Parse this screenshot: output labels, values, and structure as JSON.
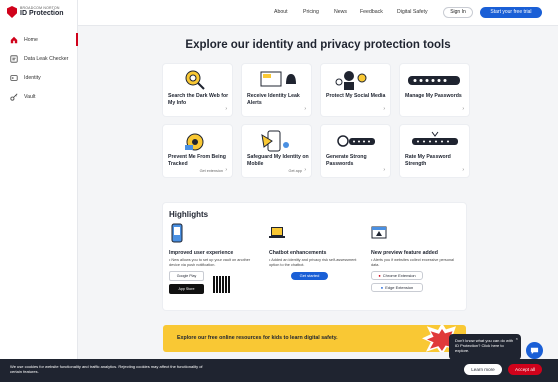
{
  "brand": {
    "top": "BROADCOM NORTON",
    "name": "ID Protection"
  },
  "sidebar": {
    "items": [
      {
        "label": "Home",
        "icon": "home-icon"
      },
      {
        "label": "Data Leak Checker",
        "icon": "data-leak-icon"
      },
      {
        "label": "Identity",
        "icon": "id-card-icon"
      },
      {
        "label": "Vault",
        "icon": "key-icon"
      }
    ]
  },
  "topnav": {
    "about": "About",
    "pricing": "Pricing",
    "news": "News",
    "feedback": "Feedback",
    "digital_safety": "Digital Safety",
    "sign_in": "Sign In",
    "trial": "Start your free trial"
  },
  "main": {
    "headline": "Explore our identity and privacy protection tools"
  },
  "tools": [
    {
      "title": "Search the Dark Web for My Info",
      "extra": ""
    },
    {
      "title": "Receive Identity Leak Alerts",
      "extra": ""
    },
    {
      "title": "Protect My Social Media",
      "extra": ""
    },
    {
      "title": "Manage My Passwords",
      "extra": ""
    },
    {
      "title": "Prevent Me From Being Tracked",
      "extra": "Get extension"
    },
    {
      "title": "Safeguard My Identity on Mobile",
      "extra": "Get app"
    },
    {
      "title": "Generate Strong Passwords",
      "extra": ""
    },
    {
      "title": "Rate My Password Strength",
      "extra": ""
    }
  ],
  "highlights": {
    "title": "Highlights",
    "col1": {
      "title": "Improved user experience",
      "bullets": [
        "New allows you to set up your vault on another device via push notification."
      ],
      "google": "Google Play",
      "apple": "App Store"
    },
    "col2": {
      "title": "Chatbot enhancements",
      "bullets": [
        "Added an identity and privacy risk self-assessment option to the chatbot."
      ],
      "button": "Get started"
    },
    "col3": {
      "title": "New preview feature added",
      "bullets": [
        "Alerts you if websites collect excessive personal data."
      ],
      "chrome": "Chrome Extension",
      "edge": "Edge Extension"
    }
  },
  "kids": {
    "text": "Explore our free online resources for kids to learn digital safety."
  },
  "chat": {
    "text": "Don't know what you can do with ID Protection? Click here to explore."
  },
  "cookie": {
    "text": "We use cookies for website functionality and traffic analytics. Rejecting cookies may affect the functionality of certain features.",
    "learn": "Learn more",
    "accept": "Accept all"
  }
}
